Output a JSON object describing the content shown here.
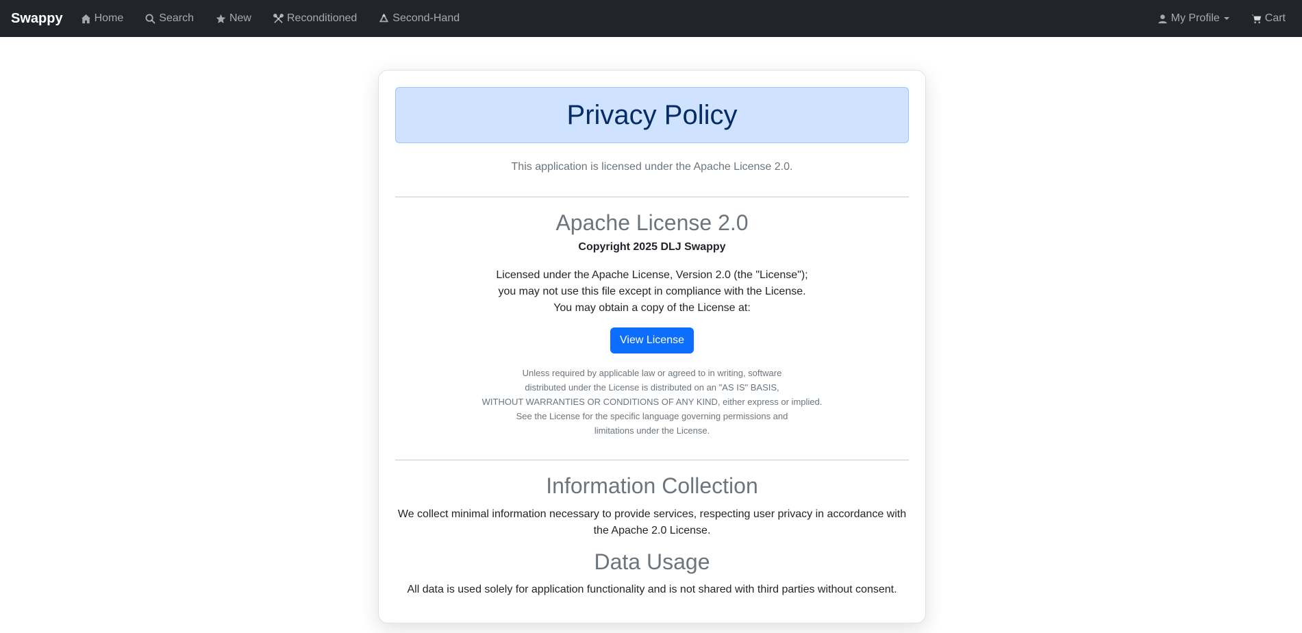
{
  "navbar": {
    "brand": "Swappy",
    "items": [
      {
        "label": "Home",
        "icon": "house-icon"
      },
      {
        "label": "Search",
        "icon": "search-icon"
      },
      {
        "label": "New",
        "icon": "star-icon"
      },
      {
        "label": "Reconditioned",
        "icon": "tools-icon"
      },
      {
        "label": "Second-Hand",
        "icon": "recycle-icon"
      }
    ],
    "profile_label": "My Profile",
    "cart_label": "Cart"
  },
  "page": {
    "title": "Privacy Policy",
    "intro": "This application is licensed under the Apache License 2.0.",
    "license": {
      "heading": "Apache License 2.0",
      "copyright": "Copyright 2025 DLJ Swappy",
      "lines": [
        "Licensed under the Apache License, Version 2.0 (the \"License\");",
        "you may not use this file except in compliance with the License.",
        "You may obtain a copy of the License at:"
      ],
      "button_label": "View License",
      "disclaimer": [
        "Unless required by applicable law or agreed to in writing, software",
        "distributed under the License is distributed on an \"AS IS\" BASIS,",
        "WITHOUT WARRANTIES OR CONDITIONS OF ANY KIND, either express or implied.",
        "See the License for the specific language governing permissions and",
        "limitations under the License."
      ]
    },
    "info_collection": {
      "heading": "Information Collection",
      "text_line1": "We collect minimal information necessary to provide services, respecting user privacy in accordance with",
      "text_line2": "the Apache 2.0 License."
    },
    "data_usage": {
      "heading": "Data Usage",
      "text": "All data is used solely for application functionality and is not shared with third parties without consent."
    }
  },
  "colors": {
    "navbar_bg": "#212529",
    "title_bg": "#cfe2ff",
    "title_text": "#052c65",
    "button_bg": "#0d6efd",
    "muted_text": "#6c757d"
  }
}
